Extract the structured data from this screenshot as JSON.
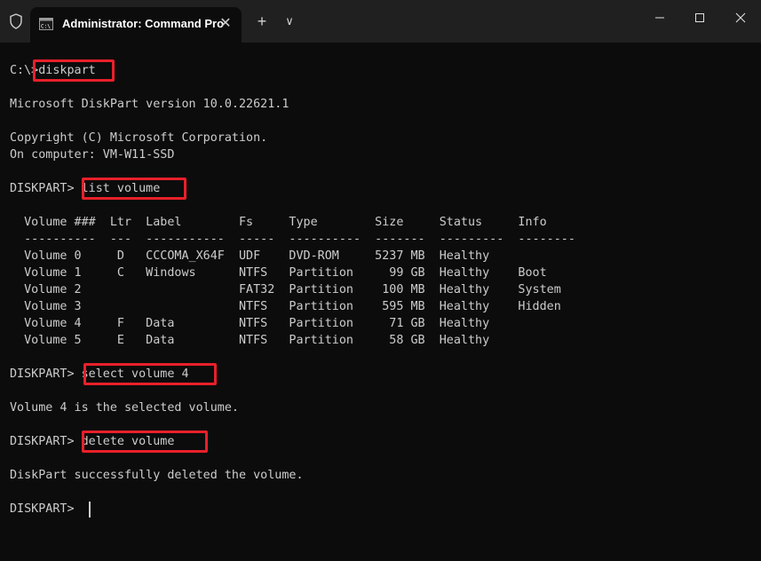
{
  "window": {
    "tab_title": "Administrator: Command Pro",
    "tab_icon": "cmd-icon",
    "shield_icon": "shield-icon",
    "new_tab_label": "+",
    "dropdown_label": "∨",
    "close_tab_label": "✕"
  },
  "terminal": {
    "lines": [
      "C:\\>diskpart",
      "Microsoft DiskPart version 10.0.22621.1",
      "Copyright (C) Microsoft Corporation.",
      "On computer: VM-W11-SSD",
      "DISKPART> list volume",
      "  Volume ###  Ltr  Label        Fs     Type        Size     Status     Info",
      "  ----------  ---  -----------  -----  ----------  -------  ---------  --------",
      "  Volume 0     D   CCCOMA_X64F  UDF    DVD-ROM     5237 MB  Healthy",
      "  Volume 1     C   Windows      NTFS   Partition     99 GB  Healthy    Boot",
      "  Volume 2                      FAT32  Partition    100 MB  Healthy    System",
      "  Volume 3                      NTFS   Partition    595 MB  Healthy    Hidden",
      "  Volume 4     F   Data         NTFS   Partition     71 GB  Healthy",
      "  Volume 5     E   Data         NTFS   Partition     58 GB  Healthy",
      "DISKPART> select volume 4",
      "Volume 4 is the selected volume.",
      "DISKPART> delete volume",
      "DiskPart successfully deleted the volume.",
      "DISKPART> "
    ]
  },
  "colors": {
    "terminal_bg": "#0c0c0c",
    "titlebar_bg": "#202020",
    "text": "#cccccc",
    "highlight": "#e8202a"
  }
}
